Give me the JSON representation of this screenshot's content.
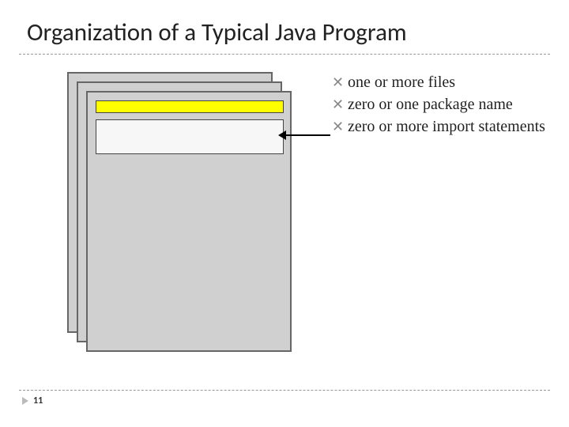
{
  "title": "Organization of a Typical Java Program",
  "bullets": [
    "one or more files",
    "zero or one package name",
    "zero or more import statements"
  ],
  "page_number": "11"
}
